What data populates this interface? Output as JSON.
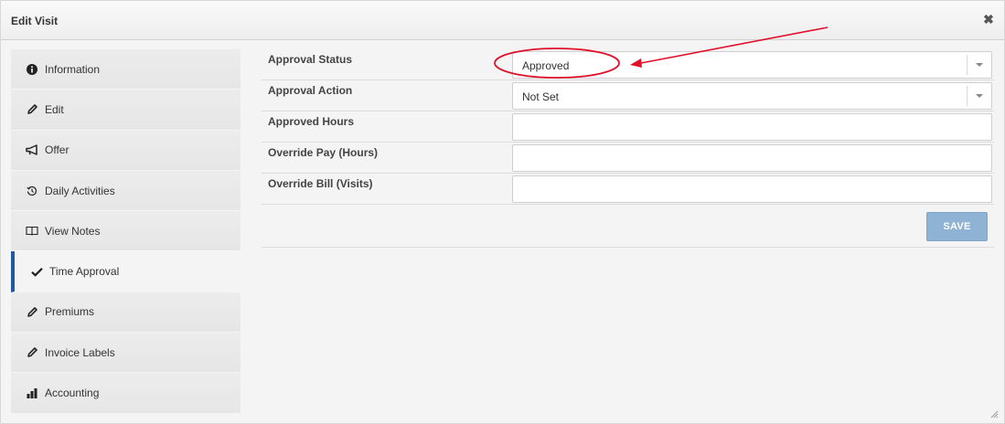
{
  "dialog": {
    "title": "Edit Visit",
    "close_icon": "close-icon"
  },
  "sidebar": {
    "items": [
      {
        "label": "Information",
        "icon": "info-circle-icon"
      },
      {
        "label": "Edit",
        "icon": "pencil-icon"
      },
      {
        "label": "Offer",
        "icon": "megaphone-icon"
      },
      {
        "label": "Daily Activities",
        "icon": "history-icon"
      },
      {
        "label": "View Notes",
        "icon": "book-icon"
      },
      {
        "label": "Time Approval",
        "icon": "check-icon",
        "active": true
      },
      {
        "label": "Premiums",
        "icon": "pencil-icon"
      },
      {
        "label": "Invoice Labels",
        "icon": "pencil-icon"
      },
      {
        "label": "Accounting",
        "icon": "bar-chart-icon"
      }
    ]
  },
  "form": {
    "approval_status": {
      "label": "Approval Status",
      "value": "Approved"
    },
    "approval_action": {
      "label": "Approval Action",
      "value": "Not Set"
    },
    "approved_hours": {
      "label": "Approved Hours",
      "value": ""
    },
    "override_pay": {
      "label": "Override Pay (Hours)",
      "value": ""
    },
    "override_bill": {
      "label": "Override Bill (Visits)",
      "value": ""
    },
    "save_label": "SAVE"
  },
  "colors": {
    "accent": "#1f5ba3",
    "save_button": "#8fb3d4",
    "annotation": "#e0102a"
  }
}
